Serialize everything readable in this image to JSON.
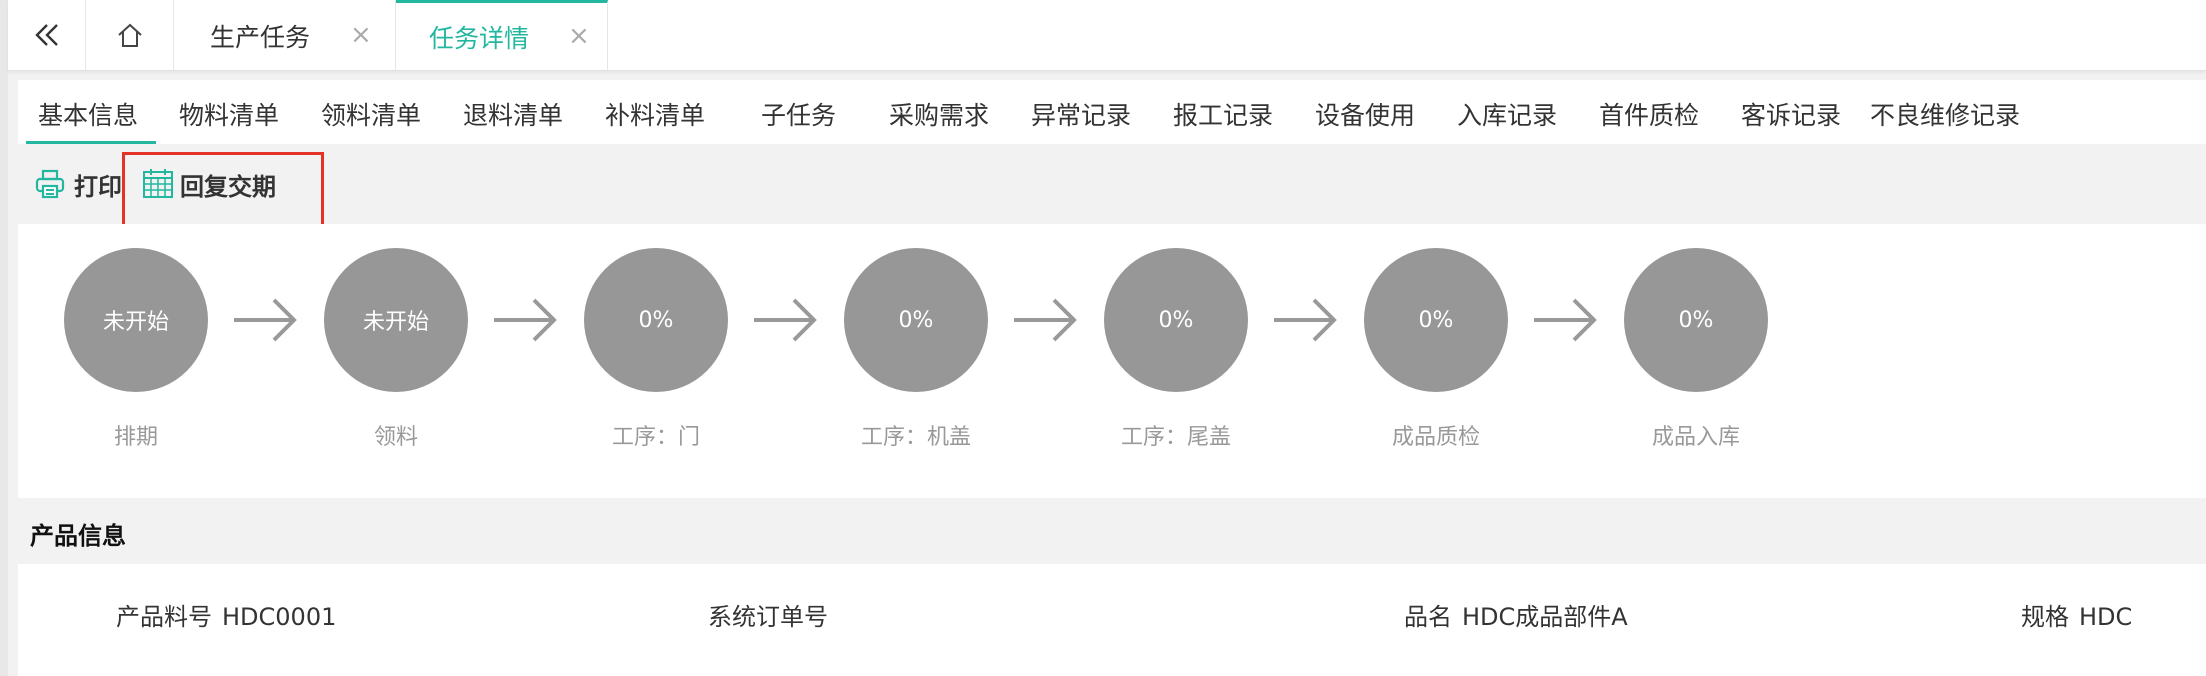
{
  "topbar": {
    "tabs": [
      {
        "label": "生产任务"
      },
      {
        "label": "任务详情"
      }
    ],
    "close_glyph": "×"
  },
  "subtabs": [
    "基本信息",
    "物料清单",
    "领料清单",
    "退料清单",
    "补料清单",
    "子任务",
    "采购需求",
    "异常记录",
    "报工记录",
    "设备使用",
    "入库记录",
    "首件质检",
    "客诉记录",
    "不良维修记录"
  ],
  "toolbar": {
    "print_label": "打印",
    "reply_label": "回复交期"
  },
  "steps": [
    {
      "status": "未开始",
      "label": "排期"
    },
    {
      "status": "未开始",
      "label": "领料"
    },
    {
      "status": "0%",
      "label": "工序：门"
    },
    {
      "status": "0%",
      "label": "工序：机盖"
    },
    {
      "status": "0%",
      "label": "工序：尾盖"
    },
    {
      "status": "0%",
      "label": "成品质检"
    },
    {
      "status": "0%",
      "label": "成品入库"
    }
  ],
  "product_info": {
    "title": "产品信息",
    "fields": [
      {
        "label": "产品料号",
        "value": "HDC0001"
      },
      {
        "label": "系统订单号",
        "value": ""
      },
      {
        "label": "品名",
        "value": "HDC成品部件A"
      },
      {
        "label": "规格",
        "value": "HDC"
      }
    ]
  },
  "colors": {
    "accent": "#23b7a0",
    "highlight": "#e53226",
    "step_circle": "#979797"
  }
}
